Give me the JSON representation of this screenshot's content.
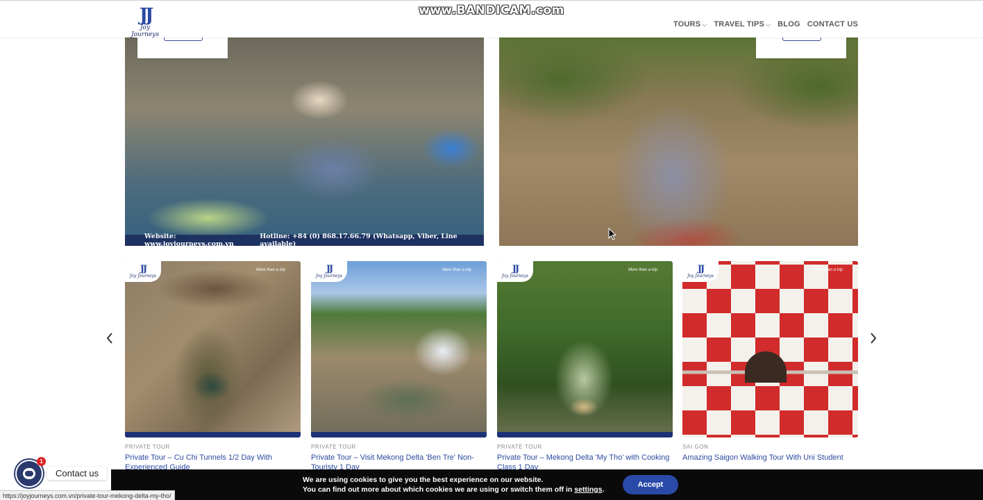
{
  "header": {
    "logo": {
      "mark": "JJ",
      "wordmark": "Joy Journeys"
    },
    "nav": [
      {
        "label": "TOURS",
        "has_dropdown": true
      },
      {
        "label": "TRAVEL TIPS",
        "has_dropdown": true
      },
      {
        "label": "BLOG",
        "has_dropdown": false
      },
      {
        "label": "CONTACT US",
        "has_dropdown": false
      }
    ]
  },
  "watermark": "www.BANDICAM.com",
  "featured": {
    "left_caption_site": "Website: www.joyjourneys.com.vn",
    "left_caption_hotline": "Hotline: +84 (0) 868.17.66.79 (Whatsapp, Viber, Line available)"
  },
  "carousel": {
    "prev_icon": "chevron-left-icon",
    "next_icon": "chevron-right-icon",
    "card_tagline": "More than a trip",
    "cards": [
      {
        "category": "PRIVATE TOUR",
        "title": "Private Tour – Cu Chi Tunnels 1/2 Day With Experienced Guide"
      },
      {
        "category": "PRIVATE TOUR",
        "title": "Private Tour – Visit Mekong Delta 'Ben Tre' Non-Touristy 1 Day"
      },
      {
        "category": "PRIVATE TOUR",
        "title": "Private Tour – Mekong Delta 'My Tho' with Cooking Class 1 Day"
      },
      {
        "category": "SAI GON",
        "title": "Amazing Saigon Walking Tour With Uni Student"
      }
    ]
  },
  "contact_widget": {
    "label": "Contact us",
    "badge_count": "1"
  },
  "cookie": {
    "line1": "We are using cookies to give you the best experience on our website.",
    "line2_prefix": "You can find out more about which cookies we are using or switch them off in ",
    "line2_link": "settings",
    "line2_suffix": ".",
    "accept_label": "Accept"
  },
  "status_url": "https://joyjourneys.com.vn/private-tour-mekong-delta-my-tho/"
}
